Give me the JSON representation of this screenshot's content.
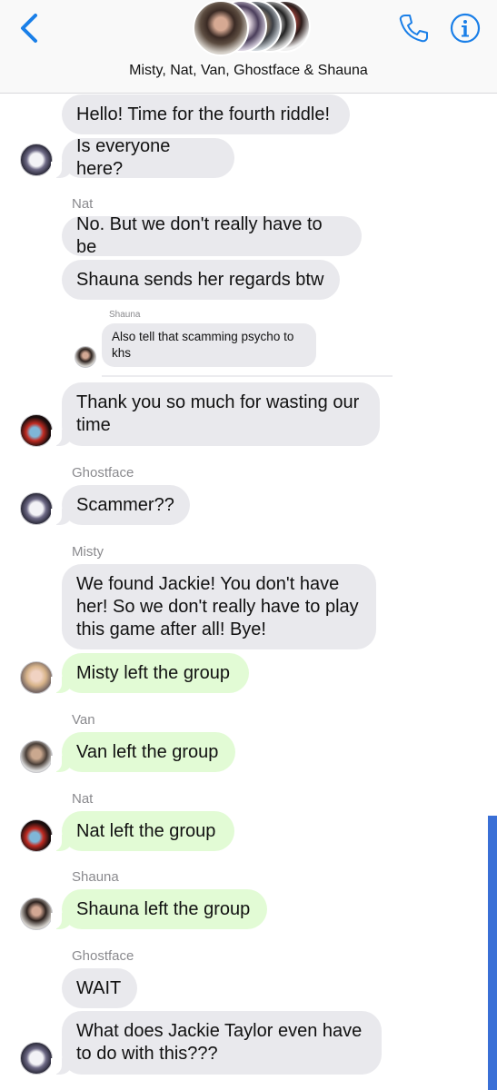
{
  "header": {
    "title": "Misty, Nat, Van, Ghostface & Shauna",
    "back_icon": "chevron-left-icon",
    "call_icon": "phone-icon",
    "info_icon": "info-icon",
    "accent": "#1a7fe8"
  },
  "messages": [
    {
      "text": "Hello! Time for the fourth riddle!"
    },
    {
      "text": "Is everyone here?"
    },
    {
      "sender": "Nat",
      "text": "No. But we don't really have to be"
    },
    {
      "text": "Shauna sends her regards btw"
    },
    {
      "sender": "Shauna",
      "text": "Also tell that scamming psycho to khs"
    },
    {
      "text": "Thank you so much for wasting our time"
    },
    {
      "sender": "Ghostface",
      "text": "Scammer??"
    },
    {
      "sender": "Misty",
      "text": "We found Jackie! You don't have her! So we don't really have to play this game after all! Bye!"
    },
    {
      "text": "Misty left the group"
    },
    {
      "sender": "Van",
      "text": "Van left the group"
    },
    {
      "sender": "Nat",
      "text": "Nat left the group"
    },
    {
      "sender": "Shauna",
      "text": "Shauna left the group"
    },
    {
      "sender": "Ghostface",
      "text": "WAIT"
    },
    {
      "text": "What does Jackie Taylor even have to do with this???"
    }
  ],
  "colors": {
    "incoming_bubble": "#e9e9ed",
    "system_bubble": "#e2fbd5",
    "sender_label": "#8a8a8e",
    "scrollbar": "#3a6fd6"
  }
}
